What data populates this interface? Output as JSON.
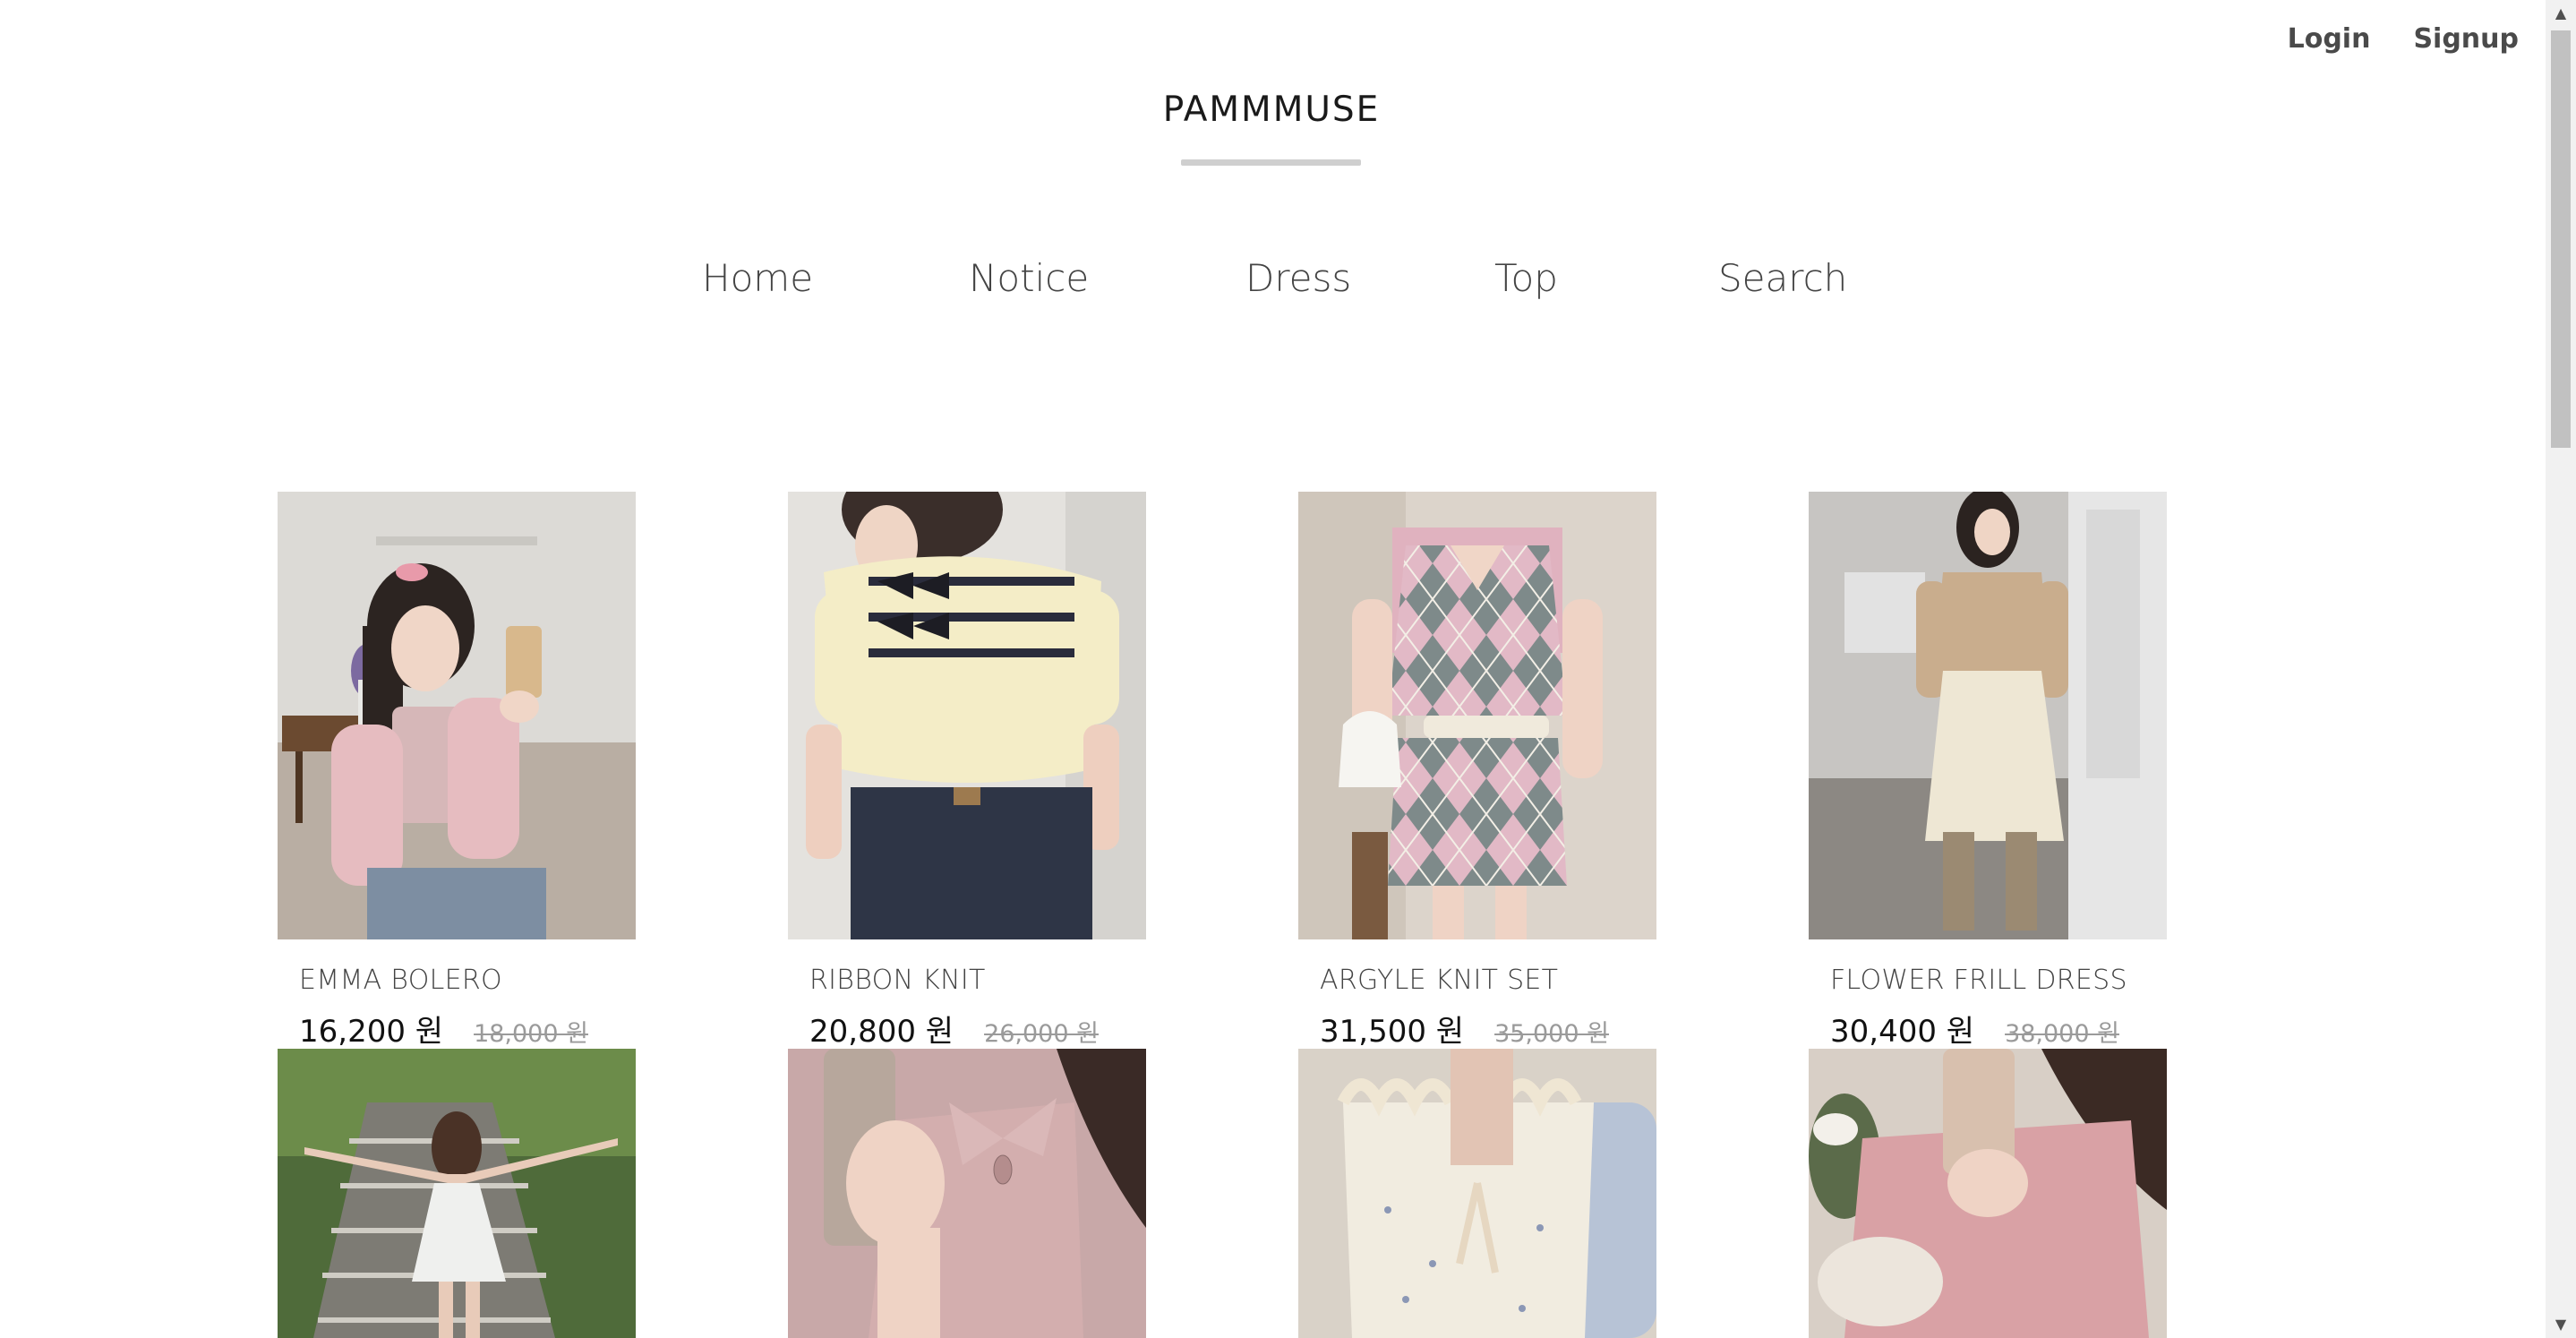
{
  "header": {
    "login_label": "Login",
    "signup_label": "Signup",
    "logo_text": "PAMMMUSE"
  },
  "nav": {
    "items": [
      {
        "label": "Home"
      },
      {
        "label": "Notice"
      },
      {
        "label": "Dress"
      },
      {
        "label": "Top"
      },
      {
        "label": "Search"
      }
    ]
  },
  "products": [
    {
      "name": "EMMA BOLERO",
      "price": "16,200 원",
      "original_price": "18,000 원",
      "image": "photo-pink-bolero"
    },
    {
      "name": "RIBBON KNIT",
      "price": "20,800 원",
      "original_price": "26,000 원",
      "image": "photo-yellow-ribbon-knit"
    },
    {
      "name": "ARGYLE KNIT SET",
      "price": "31,500 원",
      "original_price": "35,000 원",
      "image": "photo-argyle-set"
    },
    {
      "name": "FLOWER FRILL DRESS",
      "price": "30,400 원",
      "original_price": "38,000 원",
      "image": "photo-frill-dress"
    }
  ],
  "products_row2": [
    {
      "image": "photo-white-dress-stairs"
    },
    {
      "image": "photo-pink-collar-top"
    },
    {
      "image": "photo-floral-frill-top"
    },
    {
      "image": "photo-pink-knit"
    }
  ],
  "colors": {
    "background": "#ffffff",
    "text": "#444444",
    "price": "#111111",
    "original_price": "#9a9a9a",
    "logo_bar": "#cfcfcf"
  }
}
